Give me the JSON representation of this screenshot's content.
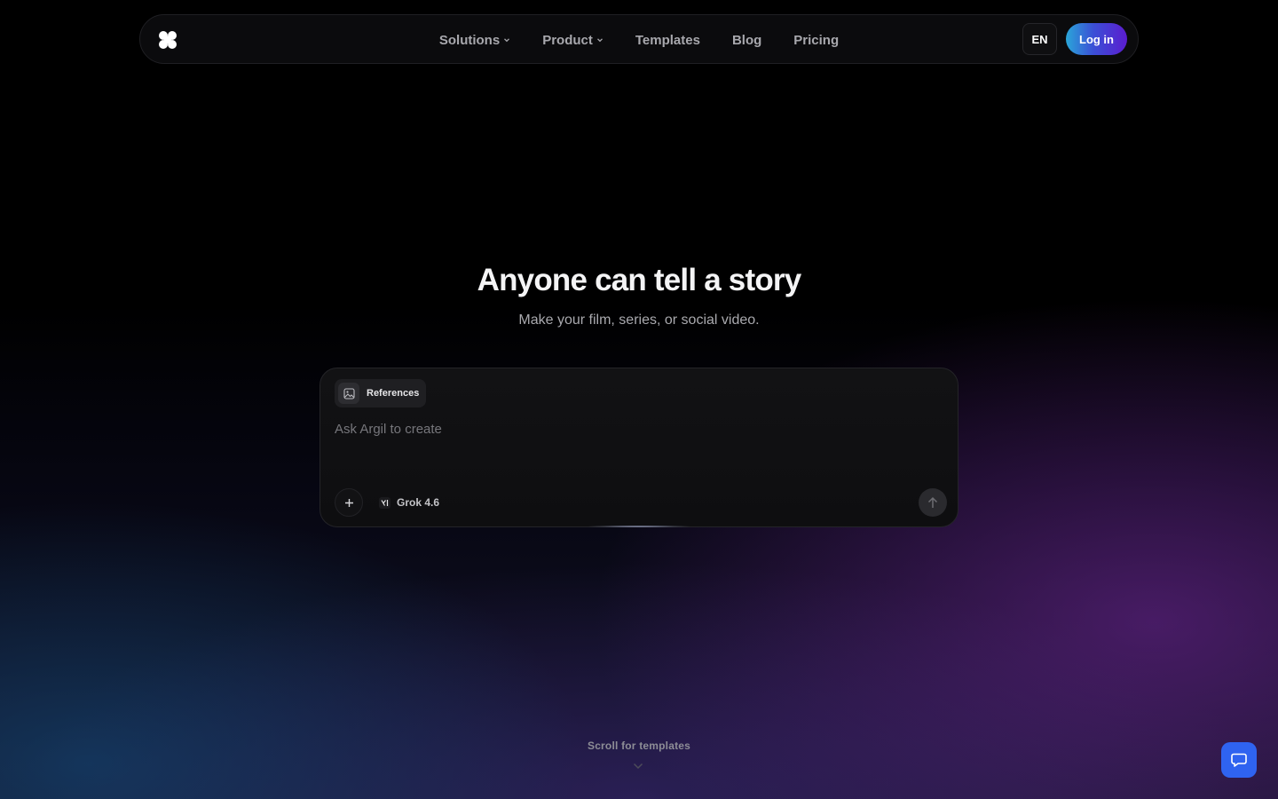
{
  "nav": {
    "logo_icon": "clover-logo-icon",
    "links": [
      {
        "label": "Solutions",
        "has_dropdown": true
      },
      {
        "label": "Product",
        "has_dropdown": true
      },
      {
        "label": "Templates",
        "has_dropdown": false
      },
      {
        "label": "Blog",
        "has_dropdown": false
      },
      {
        "label": "Pricing",
        "has_dropdown": false
      }
    ],
    "language": "EN",
    "login_label": "Log in"
  },
  "hero": {
    "title": "Anyone can tell a story",
    "subtitle": "Make your film, series, or social video."
  },
  "prompt": {
    "references_label": "References",
    "references_icon": "image-icon",
    "placeholder": "Ask Argil to create",
    "value": "",
    "add_icon": "plus-icon",
    "model_label": "Grok 4.6",
    "model_icon": "xai-logo-icon",
    "send_icon": "arrow-up-icon"
  },
  "scroll_hint": {
    "label": "Scroll for templates",
    "icon": "chevron-down-icon"
  },
  "help": {
    "icon": "chat-bubble-icon"
  },
  "colors": {
    "background": "#000000",
    "login_gradient_start": "#2aa6d8",
    "login_gradient_end": "#5b1ccf",
    "help_button": "#2f63f0"
  }
}
